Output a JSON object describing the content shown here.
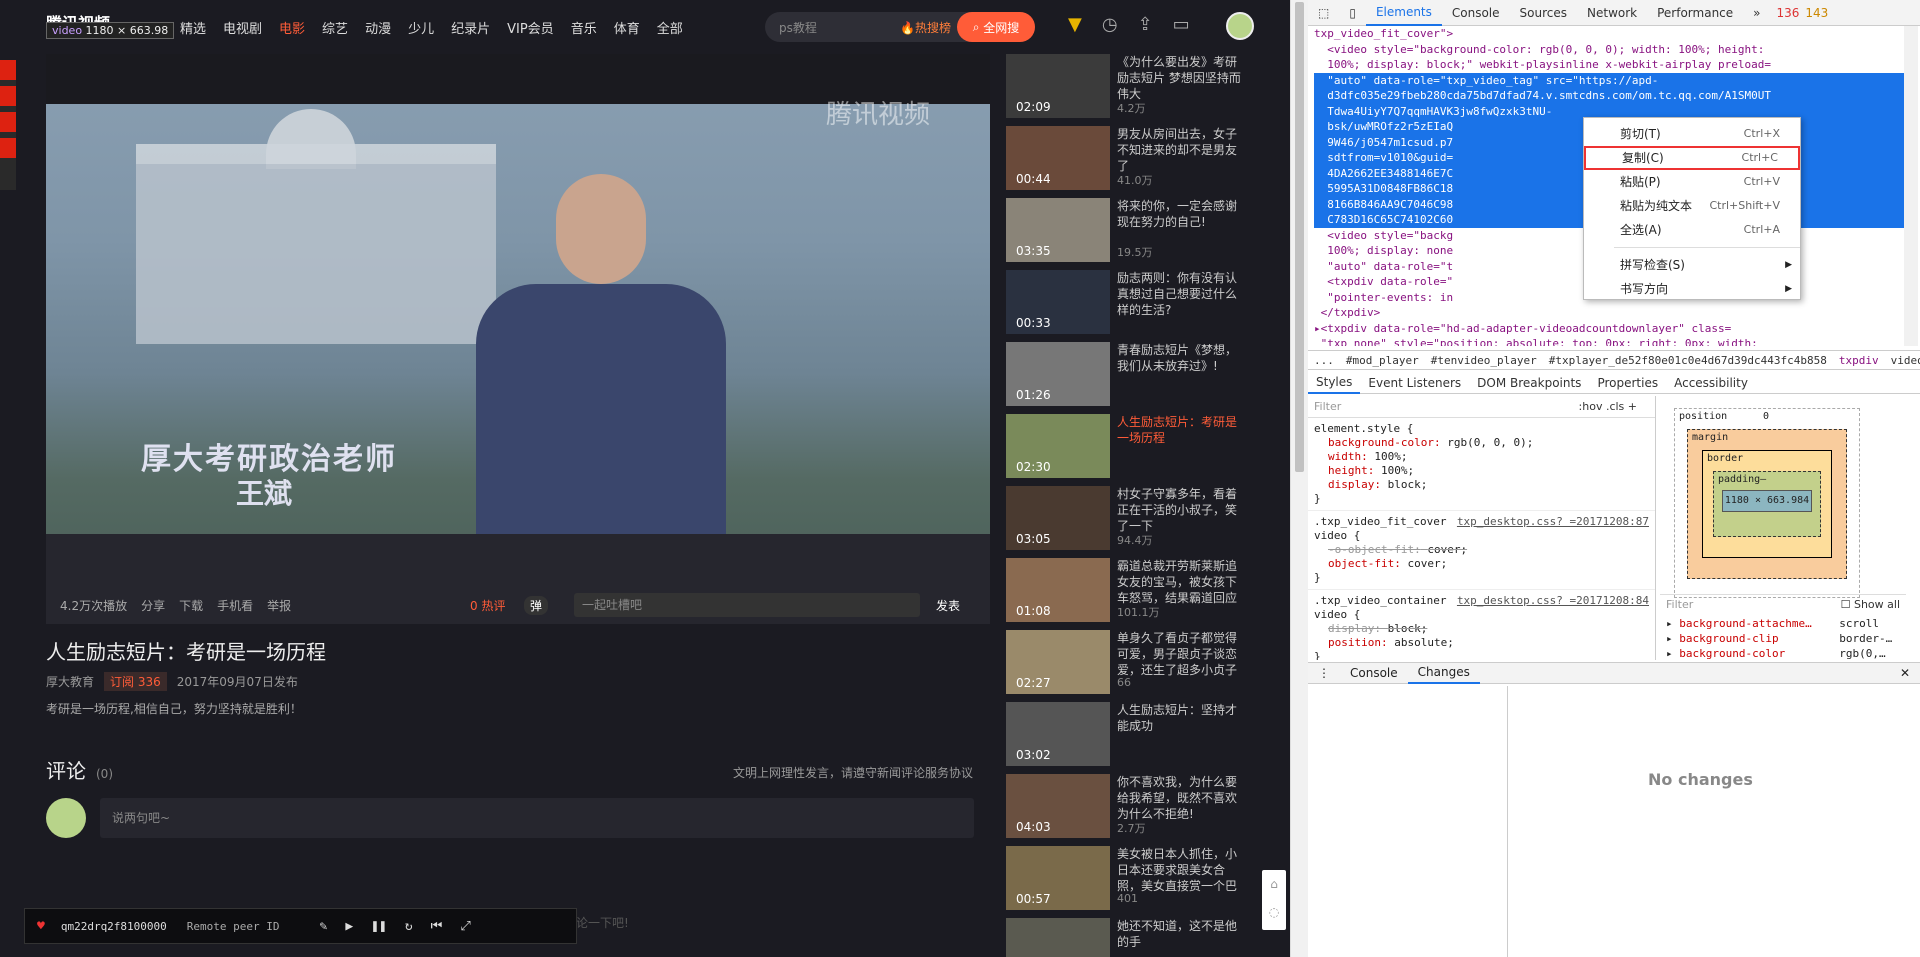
{
  "header": {
    "logo": "腾讯视频",
    "video_tag_name": "video",
    "video_tag_size": "1180 × 663.98",
    "nav": [
      "精选",
      "电视剧",
      "电影",
      "综艺",
      "动漫",
      "少儿",
      "纪录片",
      "VIP会员",
      "音乐",
      "体育",
      "全部"
    ],
    "nav_active": "电影",
    "search_placeholder": "ps教程",
    "hot_label": "热搜榜",
    "search_button": "全网搜"
  },
  "player": {
    "watermark": "腾讯视频",
    "caption_line1": "厚大考研政治老师",
    "caption_line2": "王斌"
  },
  "controls": {
    "plays": "4.2万次播放",
    "share": "分享",
    "download": "下载",
    "mobile": "手机看",
    "report": "举报",
    "hot_comments": "0 热评",
    "danmu": "弹",
    "danmu_placeholder": "一起吐槽吧",
    "send": "发表"
  },
  "video": {
    "title": "人生励志短片：考研是一场历程",
    "channel": "厚大教育",
    "subscribe": "订阅  336",
    "date": "2017年09月07日发布",
    "desc": "考研是一场历程,相信自己，努力坚持就是胜利！"
  },
  "comments": {
    "heading": "评论",
    "count": "(0)",
    "note": "文明上网理性发言，请遵守新闻评论服务协议",
    "placeholder": "说两句吧~"
  },
  "peerbar": {
    "id": "qm22drq2f8100000",
    "remote": "Remote peer ID",
    "ghost": "暂无评论，快来评论一下吧!"
  },
  "sidebar": [
    {
      "dur": "02:09",
      "title": "《为什么要出发》考研励志短片 梦想因坚持而伟大",
      "count": "4.2万",
      "tint": "#3b3b3b",
      "active": false
    },
    {
      "dur": "00:44",
      "title": "男友从房间出去，女子不知进来的却不是男友了",
      "count": "41.0万",
      "tint": "#6a4a3a",
      "active": false
    },
    {
      "dur": "03:35",
      "title": "将来的你，一定会感谢现在努力的自己!",
      "count": "19.5万",
      "tint": "#8a8478",
      "active": false
    },
    {
      "dur": "00:33",
      "title": "励志两则：你有没有认真想过自己想要过什么样的生活?",
      "count": "",
      "tint": "#2a3140",
      "active": false
    },
    {
      "dur": "01:26",
      "title": "青春励志短片《梦想，我们从未放弃过》!",
      "count": "",
      "tint": "#777",
      "active": false
    },
    {
      "dur": "02:30",
      "title": "人生励志短片：考研是一场历程",
      "count": "",
      "tint": "#7a8a5a",
      "active": true
    },
    {
      "dur": "03:05",
      "title": "村女子守寡多年，看着正在干活的小叔子，笑了一下",
      "count": "94.4万",
      "tint": "#4a3a30",
      "active": false
    },
    {
      "dur": "01:08",
      "title": "霸道总裁开劳斯莱斯追女友的宝马，被女孩下车怒骂，结果霸道回应",
      "count": "101.1万",
      "tint": "#8a6a50",
      "active": false
    },
    {
      "dur": "02:27",
      "title": "单身久了看贞子都觉得可爱，男子跟贞子谈恋爱，还生了超多小贞子",
      "count": "66",
      "tint": "#9a8a6a",
      "active": false
    },
    {
      "dur": "03:02",
      "title": "人生励志短片：坚持才能成功",
      "count": "",
      "tint": "#555",
      "active": false
    },
    {
      "dur": "04:03",
      "title": "你不喜欢我，为什么要给我希望，既然不喜欢为什么不拒绝!",
      "count": "2.7万",
      "tint": "#6a5040",
      "active": false
    },
    {
      "dur": "00:57",
      "title": "美女被日本人抓住，小日本还要求跟美女合照，美女直接赏一个巴",
      "count": "401",
      "tint": "#7a6a4a",
      "active": false
    },
    {
      "dur": "",
      "title": "她还不知道，这不是他的手",
      "count": "",
      "tint": "#5a5a50",
      "active": false
    }
  ],
  "devtools": {
    "tabs": [
      "Elements",
      "Console",
      "Sources",
      "Network",
      "Performance"
    ],
    "active_tab": "Elements",
    "errors": "136",
    "warnings": "143",
    "code_lines": [
      "txp_video_fit_cover\">",
      "  <video style=\"background-color: rgb(0, 0, 0); width: 100%; height:",
      "  100%; display: block;\" webkit-playsinline x-webkit-airplay preload=",
      "  \"auto\" data-role=\"txp_video_tag\" src=\"https://apd-",
      "  d3dfc035e29fbeb280cda75bd7dfad74.v.smtcdns.com/om.tc.qq.com/A1SM0UT",
      "  Tdwa4UiyY7Q7qqmHAVK3jw8fwQzxk3tNU-",
      "  bsk/uwMROfz2r5zEIaQ",
      "  9W46/j0547m1csud.p7",
      "  sdtfrom=v1010&guid=                                   vkey=3BDE8A8738",
      "  4DA2662EE3488146E7C                                   3EE1508EA9406343",
      "  5995A31D0848FB86C18                                   25D97080B796CEF",
      "  8166B846AA9C7046C98                                   BC6DF8C71A989FE",
      "  C783D16C65C74102C60                                   eo> == $0",
      "  <video style=\"backg                                  100%; height:",
      "  100%; display: none                                   rplay preload=",
      "  \"auto\" data-role=\"t",
      "  <txpdiv data-role=\"                                  style=",
      "  \"pointer-events: in",
      " </txpdiv>",
      "▸<txpdiv data-role=\"hd-ad-adapter-videoadcountdownlayer\" class=",
      " \"txp_none\" style=\"position: absolute; top: 0px; right: 0px; width:"
    ],
    "crumbs": [
      "...",
      "#mod_player",
      "#tenvideo_player",
      "#txplayer_de52f80e01c0e4d67d39dc443fc4b858",
      "txpdiv",
      "video"
    ],
    "subtabs": [
      "Styles",
      "Event Listeners",
      "DOM Breakpoints",
      "Properties",
      "Accessibility"
    ],
    "filter": "Filter",
    "filter_opts": ":hov  .cls  +",
    "rules": [
      {
        "sel": "element.style {",
        "src": "",
        "props": [
          [
            "background-color:",
            "rgb(0, 0, 0);",
            false
          ],
          [
            "width:",
            "100%;",
            false
          ],
          [
            "height:",
            "100%;",
            false
          ],
          [
            "display:",
            "block;",
            false
          ]
        ]
      },
      {
        "sel": ".txp_video_fit_cover video {",
        "src": "txp_desktop.css? =20171208:87",
        "props": [
          [
            "-o-object-fit:",
            "cover;",
            true
          ],
          [
            "object-fit:",
            "cover;",
            false
          ]
        ]
      },
      {
        "sel": ".txp_video_container video {",
        "src": "txp_desktop.css? =20171208:84",
        "props": [
          [
            "display:",
            "block;",
            true
          ],
          [
            "position:",
            "absolute;",
            false
          ]
        ]
      }
    ],
    "boxmodel": {
      "position": "position",
      "pos_val": "0",
      "margin": "margin",
      "border": "border",
      "padding": "padding–",
      "content": "1180 × 663.984",
      "dash": "–",
      "zero": "0"
    },
    "bm_filter": "Filter",
    "bm_showall": "Show all",
    "bm_props": [
      [
        "background-attachme…",
        "scroll"
      ],
      [
        "background-clip",
        "border-…"
      ],
      [
        "background-color",
        "rgb(0,…"
      ]
    ],
    "drawer_tabs": [
      "Console",
      "Changes"
    ],
    "drawer_active": "Changes",
    "no_changes": "No changes"
  },
  "context_menu": [
    {
      "label": "剪切(T)",
      "shortcut": "Ctrl+X",
      "hl": false
    },
    {
      "label": "复制(C)",
      "shortcut": "Ctrl+C",
      "hl": true
    },
    {
      "label": "粘贴(P)",
      "shortcut": "Ctrl+V",
      "hl": false
    },
    {
      "label": "粘贴为纯文本",
      "shortcut": "Ctrl+Shift+V",
      "hl": false
    },
    {
      "label": "全选(A)",
      "shortcut": "Ctrl+A",
      "hl": false
    },
    {
      "label": "拼写检查(S)",
      "shortcut": "",
      "hl": false
    },
    {
      "label": "书写方向",
      "shortcut": "",
      "hl": false
    }
  ]
}
